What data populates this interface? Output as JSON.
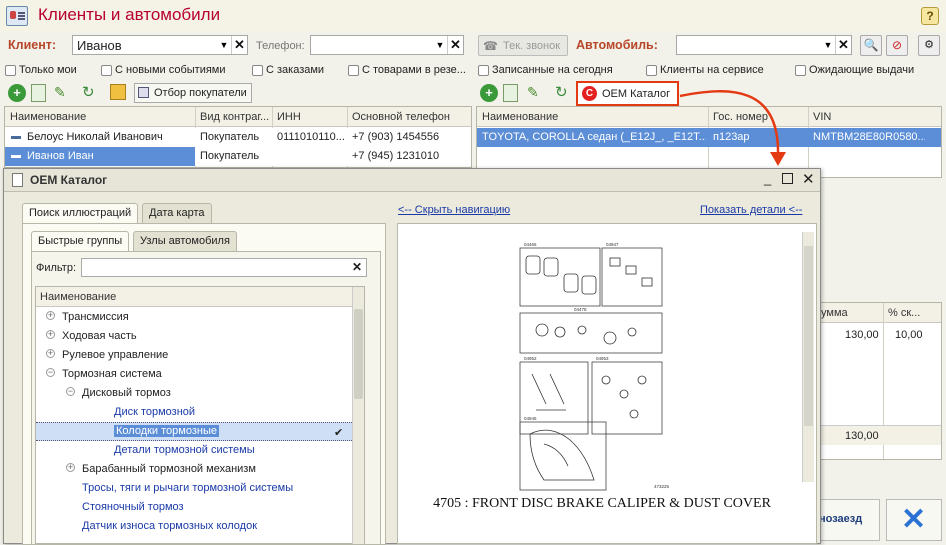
{
  "app": {
    "title": "Клиенты и автомобили",
    "help": "?"
  },
  "client": {
    "label": "Клиент:",
    "value": "Иванов",
    "phone_label": "Телефон:",
    "call_button": "Тек. звонок"
  },
  "car": {
    "label": "Автомобиль:"
  },
  "filters_left": [
    "Только мои",
    "С новыми событиями",
    "С заказами",
    "С товарами в резе..."
  ],
  "filters_right": [
    "Записанные на сегодня",
    "Клиенты на сервисе",
    "Ожидающие выдачи"
  ],
  "toolbar_left": {
    "select_buyers": "Отбор покупатели"
  },
  "toolbar_right": {
    "oem_button": "OEM Каталог"
  },
  "clients_table": {
    "headers": [
      "Наименование",
      "Вид контраг...",
      "ИНН",
      "Основной телефон"
    ],
    "rows": [
      [
        "Белоус Николай Иванович",
        "Покупатель",
        "0111010110...",
        "+7 (903) 1454556"
      ],
      [
        "Иванов Иван",
        "Покупатель",
        "",
        "+7 (945) 1231010"
      ]
    ]
  },
  "cars_table": {
    "headers": [
      "Наименование",
      "Гос. номер",
      "VIN"
    ],
    "rows": [
      [
        "TOYOTA, COROLLA седан (_E12J_, _E12T...",
        "п123ар",
        "NMTBM28E80R0580..."
      ]
    ]
  },
  "bg_table": {
    "headers": [
      "умма",
      "% ск..."
    ],
    "row": [
      "130,00",
      "10,00"
    ],
    "total": "130,00",
    "button": "нозаезд"
  },
  "dialog": {
    "title": "OEM Каталог",
    "tabs": [
      "Поиск иллюстраций",
      "Дата карта"
    ],
    "subtabs": [
      "Быстрые группы",
      "Узлы автомобиля"
    ],
    "filter_label": "Фильтр:",
    "tree_header": "Наименование",
    "tree": [
      {
        "label": "Трансмиссия",
        "level": 0,
        "expander": "+"
      },
      {
        "label": "Ходовая часть",
        "level": 0,
        "expander": "+"
      },
      {
        "label": "Рулевое управление",
        "level": 0,
        "expander": "+"
      },
      {
        "label": "Тормозная система",
        "level": 0,
        "expander": "-"
      },
      {
        "label": "Дисковый тормоз",
        "level": 1,
        "expander": "-"
      },
      {
        "label": "Диск тормозной",
        "level": 2,
        "expander": ""
      },
      {
        "label": "Колодки тормозные",
        "level": 2,
        "expander": "",
        "selected": true
      },
      {
        "label": "Детали тормозной системы",
        "level": 2,
        "expander": ""
      },
      {
        "label": "Барабанный тормозной механизм",
        "level": 1,
        "expander": "+"
      },
      {
        "label": "Тросы, тяги и рычаги тормозной системы",
        "level": 1,
        "expander": ""
      },
      {
        "label": "Стояночный тормоз",
        "level": 1,
        "expander": ""
      },
      {
        "label": "Датчик износа тормозных колодок",
        "level": 1,
        "expander": ""
      }
    ],
    "hide_nav": "<-- Скрыть навигацию",
    "show_details": "Показать детали <--",
    "image_caption": "4705 : FRONT DISC BRAKE CALIPER & DUST COVER",
    "diagram_labels": [
      "04465",
      "04947",
      "04478",
      "04952",
      "04953",
      "04945",
      "473225"
    ]
  },
  "colors": {
    "accent": "#b8002e",
    "selection": "#5b8ed6",
    "highlight_box": "#e43a14",
    "link": "#1a3aa8"
  }
}
